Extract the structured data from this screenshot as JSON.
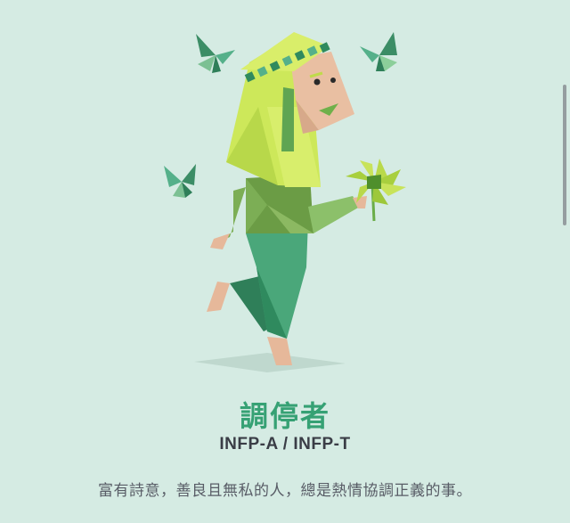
{
  "personality": {
    "title": "調停者",
    "types": "INFP-A / INFP-T",
    "description": "富有詩意，善良且無私的人，總是熱情協調正義的事。"
  },
  "colors": {
    "background": "#d5ebe3",
    "title": "#36a174",
    "subtitle": "#3a3d46",
    "description": "#585c66"
  }
}
